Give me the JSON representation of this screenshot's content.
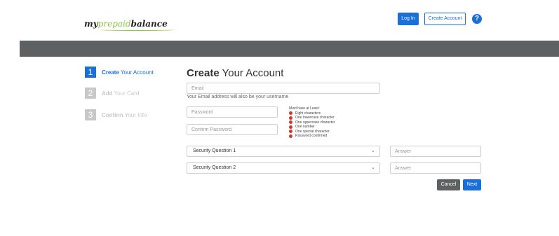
{
  "header": {
    "logo": {
      "part1": "my",
      "part2": "prepaid",
      "part3": "balance"
    },
    "login_label": "Log In",
    "create_account_label": "Create Account",
    "help_symbol": "?"
  },
  "steps": [
    {
      "number": "1",
      "label_bold": "Create",
      "label_rest": " Your Account",
      "state": "active"
    },
    {
      "number": "2",
      "label_bold": "Add",
      "label_rest": " Your Card",
      "state": "inactive"
    },
    {
      "number": "3",
      "label_bold": "Confirm",
      "label_rest": " Your Info",
      "state": "inactive"
    }
  ],
  "form": {
    "title_bold": "Create",
    "title_rest": " Your Account",
    "email_placeholder": "Email",
    "email_hint": "Your Email address will also be your username",
    "password_placeholder": "Password",
    "confirm_password_placeholder": "Confirm Password",
    "password_rules_heading": "Must have at Least:",
    "password_rules": [
      "Eight characters",
      "One lowercase character",
      "One uppercase character",
      "One number",
      "One special character",
      "Password confirmed"
    ],
    "security_question_1": "Security Question 1",
    "security_question_2": "Security Question 2",
    "answer_placeholder": "Answer",
    "cancel_label": "Cancel",
    "next_label": "Next"
  },
  "colors": {
    "accent": "#1a6fd8",
    "banner": "#5f6061",
    "logo_green": "#8dc63f",
    "rule_error": "#d9342b"
  },
  "icons": {
    "help": "question-circle-icon",
    "select_caret": "chevron-down-icon",
    "rule_status": "error-dot-icon"
  }
}
